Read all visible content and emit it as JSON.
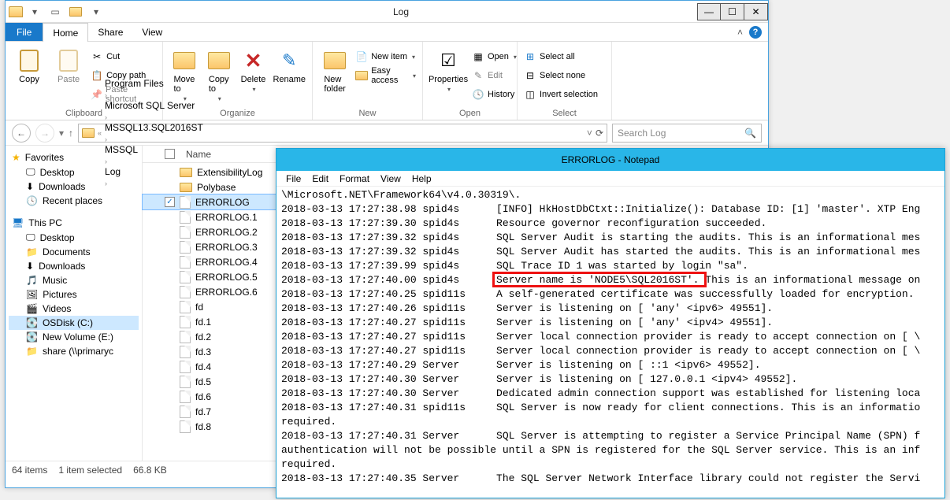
{
  "explorer": {
    "title": "Log",
    "tabs": {
      "file": "File",
      "home": "Home",
      "share": "Share",
      "view": "View"
    },
    "ribbon": {
      "clipboard": {
        "label": "Clipboard",
        "copy": "Copy",
        "paste": "Paste",
        "cut": "Cut",
        "copypath": "Copy path",
        "pasteshortcut": "Paste shortcut"
      },
      "organize": {
        "label": "Organize",
        "moveto": "Move\nto",
        "copyto": "Copy\nto",
        "delete": "Delete",
        "rename": "Rename"
      },
      "new": {
        "label": "New",
        "newfolder": "New\nfolder",
        "newitem": "New item",
        "easyaccess": "Easy access"
      },
      "open": {
        "label": "Open",
        "properties": "Properties",
        "open": "Open",
        "edit": "Edit",
        "history": "History"
      },
      "select": {
        "label": "Select",
        "selectall": "Select all",
        "selectnone": "Select none",
        "invert": "Invert selection"
      }
    },
    "breadcrumb": [
      "Program Files",
      "Microsoft SQL Server",
      "MSSQL13.SQL2016ST",
      "MSSQL",
      "Log"
    ],
    "search_placeholder": "Search Log",
    "nav": {
      "favorites": {
        "label": "Favorites",
        "items": [
          "Desktop",
          "Downloads",
          "Recent places"
        ]
      },
      "thispc": {
        "label": "This PC",
        "items": [
          "Desktop",
          "Documents",
          "Downloads",
          "Music",
          "Pictures",
          "Videos",
          "OSDisk (C:)",
          "New Volume (E:)",
          "share (\\\\primaryc"
        ]
      }
    },
    "columns": {
      "name": "Name"
    },
    "files": [
      {
        "name": "ExtensibilityLog",
        "type": "folder"
      },
      {
        "name": "Polybase",
        "type": "folder"
      },
      {
        "name": "ERRORLOG",
        "type": "file",
        "selected": true
      },
      {
        "name": "ERRORLOG.1",
        "type": "file"
      },
      {
        "name": "ERRORLOG.2",
        "type": "file"
      },
      {
        "name": "ERRORLOG.3",
        "type": "file"
      },
      {
        "name": "ERRORLOG.4",
        "type": "file"
      },
      {
        "name": "ERRORLOG.5",
        "type": "file"
      },
      {
        "name": "ERRORLOG.6",
        "type": "file"
      },
      {
        "name": "fd",
        "type": "file"
      },
      {
        "name": "fd.1",
        "type": "file"
      },
      {
        "name": "fd.2",
        "type": "file"
      },
      {
        "name": "fd.3",
        "type": "file"
      },
      {
        "name": "fd.4",
        "type": "file"
      },
      {
        "name": "fd.5",
        "type": "file"
      },
      {
        "name": "fd.6",
        "type": "file"
      },
      {
        "name": "fd.7",
        "type": "file"
      },
      {
        "name": "fd.8",
        "type": "file"
      }
    ],
    "status": {
      "items": "64 items",
      "selected": "1 item selected",
      "size": "66.8 KB"
    }
  },
  "notepad": {
    "title": "ERRORLOG - Notepad",
    "menu": [
      "File",
      "Edit",
      "Format",
      "View",
      "Help"
    ],
    "lines": [
      "\\Microsoft.NET\\Framework64\\v4.0.30319\\.",
      "2018-03-13 17:27:38.98 spid4s      [INFO] HkHostDbCtxt::Initialize(): Database ID: [1] 'master'. XTP Eng",
      "2018-03-13 17:27:39.30 spid4s      Resource governor reconfiguration succeeded.",
      "2018-03-13 17:27:39.32 spid4s      SQL Server Audit is starting the audits. This is an informational mes",
      "2018-03-13 17:27:39.32 spid4s      SQL Server Audit has started the audits. This is an informational mes",
      "2018-03-13 17:27:39.99 spid4s      SQL Trace ID 1 was started by login \"sa\".",
      "2018-03-13 17:27:40.00 spid4s      Server name is 'NODE5\\SQL2016ST'. This is an informational message on",
      "2018-03-13 17:27:40.25 spid11s     A self-generated certificate was successfully loaded for encryption.",
      "2018-03-13 17:27:40.26 spid11s     Server is listening on [ 'any' <ipv6> 49551].",
      "2018-03-13 17:27:40.27 spid11s     Server is listening on [ 'any' <ipv4> 49551].",
      "2018-03-13 17:27:40.27 spid11s     Server local connection provider is ready to accept connection on [ \\",
      "2018-03-13 17:27:40.27 spid11s     Server local connection provider is ready to accept connection on [ \\",
      "2018-03-13 17:27:40.29 Server      Server is listening on [ ::1 <ipv6> 49552].",
      "2018-03-13 17:27:40.30 Server      Server is listening on [ 127.0.0.1 <ipv4> 49552].",
      "2018-03-13 17:27:40.30 Server      Dedicated admin connection support was established for listening loca",
      "2018-03-13 17:27:40.31 spid11s     SQL Server is now ready for client connections. This is an informatio",
      "required.",
      "2018-03-13 17:27:40.31 Server      SQL Server is attempting to register a Service Principal Name (SPN) f",
      "authentication will not be possible until a SPN is registered for the SQL Server service. This is an inf",
      "required.",
      "2018-03-13 17:27:40.35 Server      The SQL Server Network Interface library could not register the Servi"
    ],
    "highlight_line": 6
  }
}
